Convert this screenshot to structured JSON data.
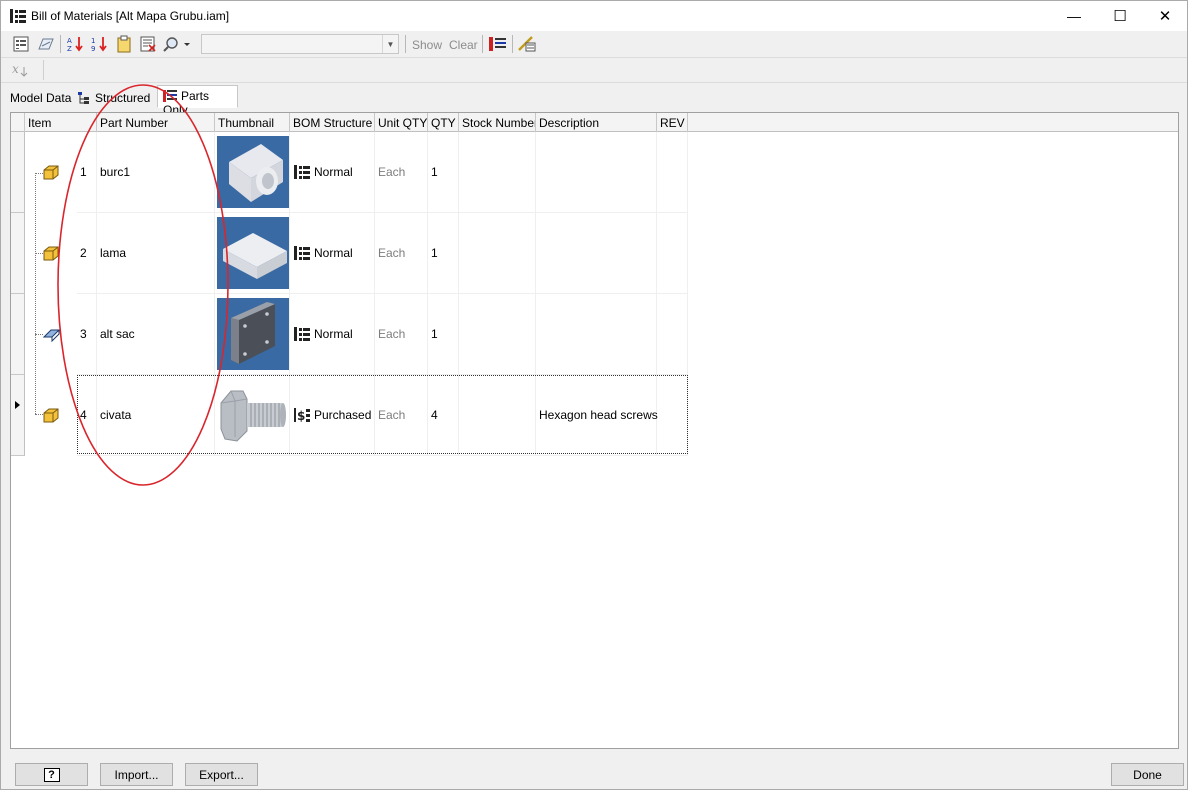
{
  "window": {
    "title": "Bill of Materials [Alt Mapa Grubu.iam]",
    "controls": {
      "minimize": "—",
      "maximize": "☐",
      "close": "✕"
    }
  },
  "toolbar": {
    "view_select_value": "",
    "show_label": "Show",
    "clear_label": "Clear",
    "icons": [
      "bom-view-icon",
      "edit-icon",
      "sort-ascending-icon",
      "sort-descending-icon",
      "clipboard-icon",
      "filter-icon",
      "find-icon",
      "columns-icon",
      "update-icon"
    ]
  },
  "formula_bar": {
    "icon": "fx-icon",
    "value": ""
  },
  "tabs": [
    {
      "label": "Model Data",
      "icon": ""
    },
    {
      "label": "Structured",
      "icon": "structured-tree-icon"
    },
    {
      "label": "Parts Only",
      "icon": "parts-list-icon",
      "active": true
    }
  ],
  "table": {
    "columns": [
      "Item",
      "Part Number",
      "Thumbnail",
      "BOM Structure",
      "Unit QTY",
      "QTY",
      "Stock Number",
      "Description",
      "REV"
    ],
    "rows": [
      {
        "item": "1",
        "part_number": "burc1",
        "thumbnail": "tube-part",
        "bom_structure": "Normal",
        "unit_qty": "Each",
        "qty": "1",
        "stock_number": "",
        "description": "",
        "rev": "",
        "item_icon": "part-icon"
      },
      {
        "item": "2",
        "part_number": "lama",
        "thumbnail": "block-part",
        "bom_structure": "Normal",
        "unit_qty": "Each",
        "qty": "1",
        "stock_number": "",
        "description": "",
        "rev": "",
        "item_icon": "part-icon"
      },
      {
        "item": "3",
        "part_number": "alt sac",
        "thumbnail": "plate-part",
        "bom_structure": "Normal",
        "unit_qty": "Each",
        "qty": "1",
        "stock_number": "",
        "description": "",
        "rev": "",
        "item_icon": "sheet-metal-part-icon"
      },
      {
        "item": "4",
        "part_number": "civata",
        "thumbnail": "bolt-part",
        "bom_structure": "Purchased",
        "unit_qty": "Each",
        "qty": "4",
        "stock_number": "",
        "description": "Hexagon head screws",
        "rev": "",
        "item_icon": "part-icon"
      }
    ]
  },
  "buttons": {
    "help": "?",
    "import": "Import...",
    "export": "Export...",
    "done": "Done"
  },
  "colors": {
    "annotation": "#d9262c",
    "thumbnail_bg": "#3a6aa3",
    "part_icon": "#f3c13a"
  }
}
